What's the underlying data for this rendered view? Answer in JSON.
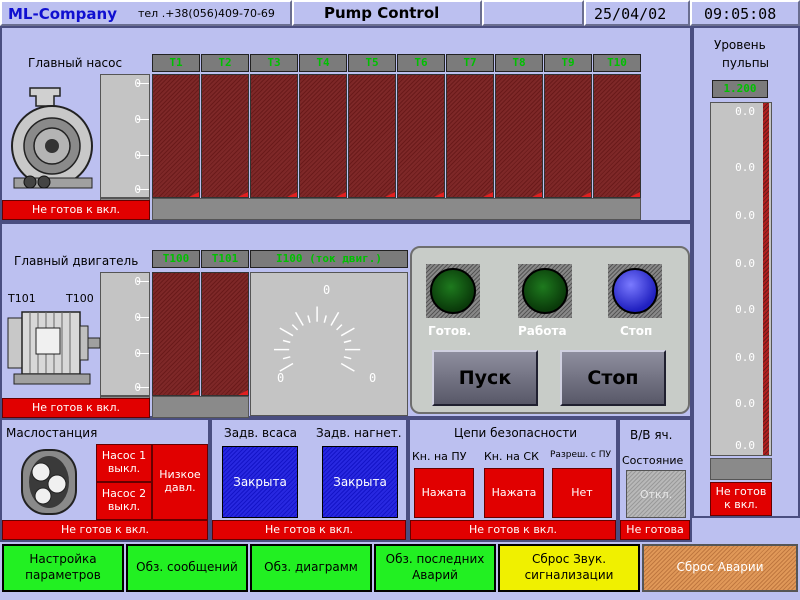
{
  "header": {
    "company": "ML-Company",
    "phone": "тел .+38(056)409-70-69",
    "title": "Pump Control",
    "date": "25/04/02",
    "time": "09:05:08"
  },
  "main_pump": {
    "label": "Главный насос",
    "scale_labels": [
      "0",
      "0",
      "0",
      "0"
    ],
    "channels": [
      "T1",
      "T2",
      "T3",
      "T4",
      "T5",
      "T6",
      "T7",
      "T8",
      "T9",
      "T10"
    ],
    "status": "Не готов к вкл."
  },
  "main_motor": {
    "label": "Главный двигатель",
    "t101_label": "T101",
    "t100_label": "T100",
    "scale_labels": [
      "0",
      "0",
      "0",
      "0"
    ],
    "channels": [
      "T100",
      "T101"
    ],
    "current_header": "I100 (ток двиг.)",
    "gauge_top": "0",
    "gauge_left": "0",
    "gauge_right": "0",
    "status": "Не готов к вкл."
  },
  "lamps": {
    "ready": "Готов.",
    "work": "Работа",
    "stop": "Стоп"
  },
  "controls": {
    "start": "Пуск",
    "stop": "Стоп"
  },
  "level": {
    "title_line1": "Уровень",
    "title_line2": "пульпы",
    "value": "1.200",
    "scale_labels": [
      "0.0",
      "0.0",
      "0.0",
      "0.0",
      "0.0",
      "0.0",
      "0.0",
      "0.0"
    ],
    "status": "Не готов к вкл."
  },
  "oil_station": {
    "label": "Маслостанция",
    "pump1": "Насос 1 выкл.",
    "pump2": "Насос 2 выкл.",
    "low_pressure": "Низкое давл.",
    "status": "Не готов к вкл."
  },
  "valves": {
    "suction_label": "Задв. всаса",
    "discharge_label": "Задв. нагнет.",
    "suction_state": "Закрыта",
    "discharge_state": "Закрыта",
    "status": "Не готов к вкл."
  },
  "safety": {
    "label": "Цепи безопасности",
    "pu_label": "Кн. на ПУ",
    "sk_label": "Кн. на СК",
    "perm_label": "Разреш. с ПУ",
    "pu_state": "Нажата",
    "sk_state": "Нажата",
    "perm_state": "Нет",
    "status": "Не готов к вкл."
  },
  "hv_cell": {
    "label": "В/В яч.",
    "state_label": "Состояние",
    "state_value": "Откл.",
    "status": "Не готова"
  },
  "buttons": {
    "settings": "Настройка параметров",
    "messages": "Обз. сообщений",
    "diagrams": "Обз. диаграмм",
    "last_alarms": "Обз. последних Аварий",
    "reset_sound": "Сброс Звук. сигнализации",
    "reset_alarm": "Сброс Аварии"
  },
  "colors": {
    "background": "#bcc0f0",
    "alarm_red": "#e10000",
    "nav_green": "#22f022",
    "sound_yellow": "#f0f000",
    "alarm_reset_orange": "#d08848",
    "channel_header_text": "#00c000",
    "closed_valve_blue": "#1414c8"
  }
}
